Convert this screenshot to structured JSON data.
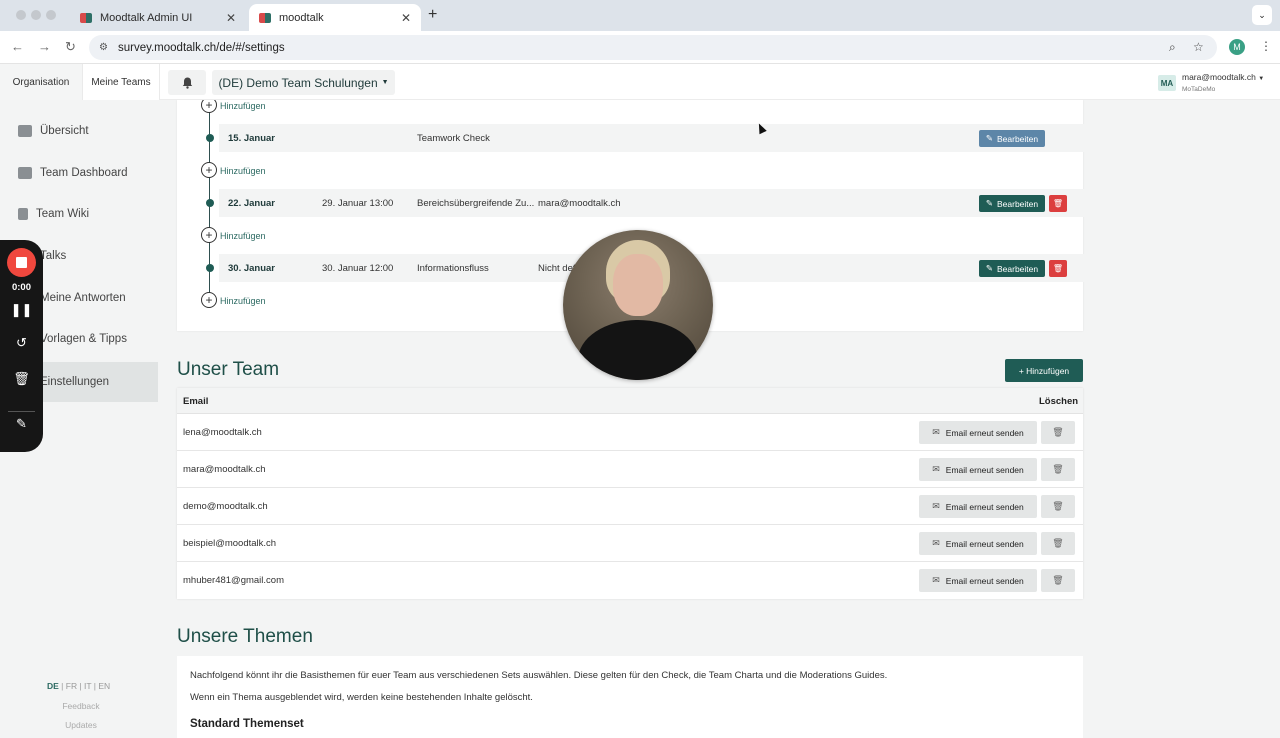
{
  "browser": {
    "tabs": [
      {
        "title": "Moodtalk Admin UI",
        "active": false
      },
      {
        "title": "moodtalk",
        "active": true
      }
    ],
    "url": "survey.moodtalk.ch/de/#/settings",
    "profile_initial": "M"
  },
  "header": {
    "tab_org": "Organisation",
    "tab_teams": "Meine Teams",
    "team_select": "(DE) Demo Team Schulungen",
    "user_badge": "MA",
    "user_email": "mara@moodtalk.ch",
    "user_org": "MoTaDeMo"
  },
  "sidebar": {
    "items": [
      {
        "label": "Übersicht"
      },
      {
        "label": "Team Dashboard"
      },
      {
        "label": "Team Wiki"
      },
      {
        "label": "Talks"
      },
      {
        "label": "Meine Antworten"
      },
      {
        "label": "Vorlagen & Tipps"
      },
      {
        "label": "Einstellungen",
        "active": true
      }
    ],
    "langs": [
      "DE",
      "FR",
      "IT",
      "EN"
    ],
    "feedback": "Feedback",
    "updates": "Updates"
  },
  "recorder": {
    "time": "0:00"
  },
  "timeline": {
    "add_label": "Hinzufügen",
    "edit_label": "Bearbeiten",
    "rows": [
      {
        "date": "15. Januar",
        "deadline": "",
        "title": "Teamwork Check",
        "owner": ""
      },
      {
        "date": "22. Januar",
        "deadline": "29. Januar 13:00",
        "title": "Bereichsübergreifende Zu...",
        "owner": "mara@moodtalk.ch"
      },
      {
        "date": "30. Januar",
        "deadline": "30. Januar 12:00",
        "title": "Informationsfluss",
        "owner": "Nicht definie"
      }
    ]
  },
  "team": {
    "title": "Unser Team",
    "add_button": "+ Hinzufügen",
    "col_email": "Email",
    "col_delete": "Löschen",
    "resend_label": "Email erneut senden",
    "members": [
      "lena@moodtalk.ch",
      "mara@moodtalk.ch",
      "demo@moodtalk.ch",
      "beispiel@moodtalk.ch",
      "mhuber481@gmail.com"
    ]
  },
  "themes": {
    "title": "Unsere Themen",
    "line1": "Nachfolgend könnt ihr die Basisthemen für euer Team aus verschiedenen Sets auswählen. Diese gelten für den Check, die Team Charta und die Moderations Guides.",
    "line2": "Wenn ein Thema ausgeblendet wird, werden keine bestehenden Inhalte gelöscht.",
    "subheading": "Standard Themenset"
  }
}
